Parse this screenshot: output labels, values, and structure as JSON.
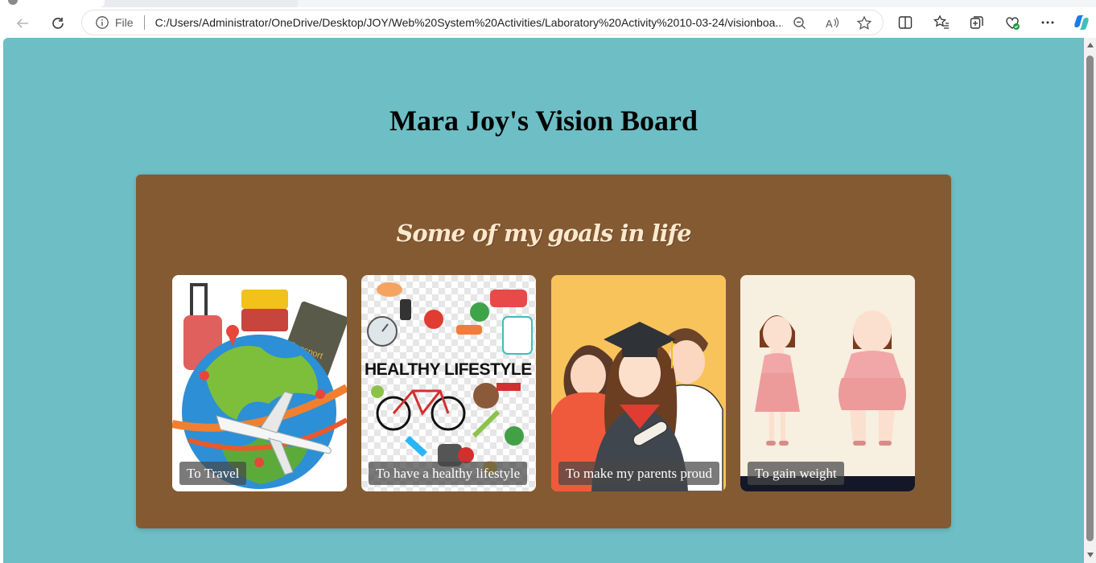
{
  "browser": {
    "address_scheme": "File",
    "url": "C:/Users/Administrator/OneDrive/Desktop/JOY/Web%20System%20Activities/Laboratory%20Activity%2010-03-24/visionboa..."
  },
  "page": {
    "title": "Mara Joy's Vision Board",
    "subtitle": "Some of my goals in life"
  },
  "cards": [
    {
      "caption": "To Travel",
      "image_icon": "travel-globe-illustration"
    },
    {
      "caption": "To have a healthy lifestyle",
      "image_icon": "healthy-lifestyle-illustration",
      "image_text": "HEALTHY LIFESTYLE"
    },
    {
      "caption": "To make my parents proud",
      "image_icon": "graduation-family-illustration"
    },
    {
      "caption": "To gain weight",
      "image_icon": "weight-gain-illustration"
    }
  ],
  "colors": {
    "page_background": "#6dbec5",
    "board_background": "#845a33",
    "subtitle_color": "#fbe9cf"
  }
}
